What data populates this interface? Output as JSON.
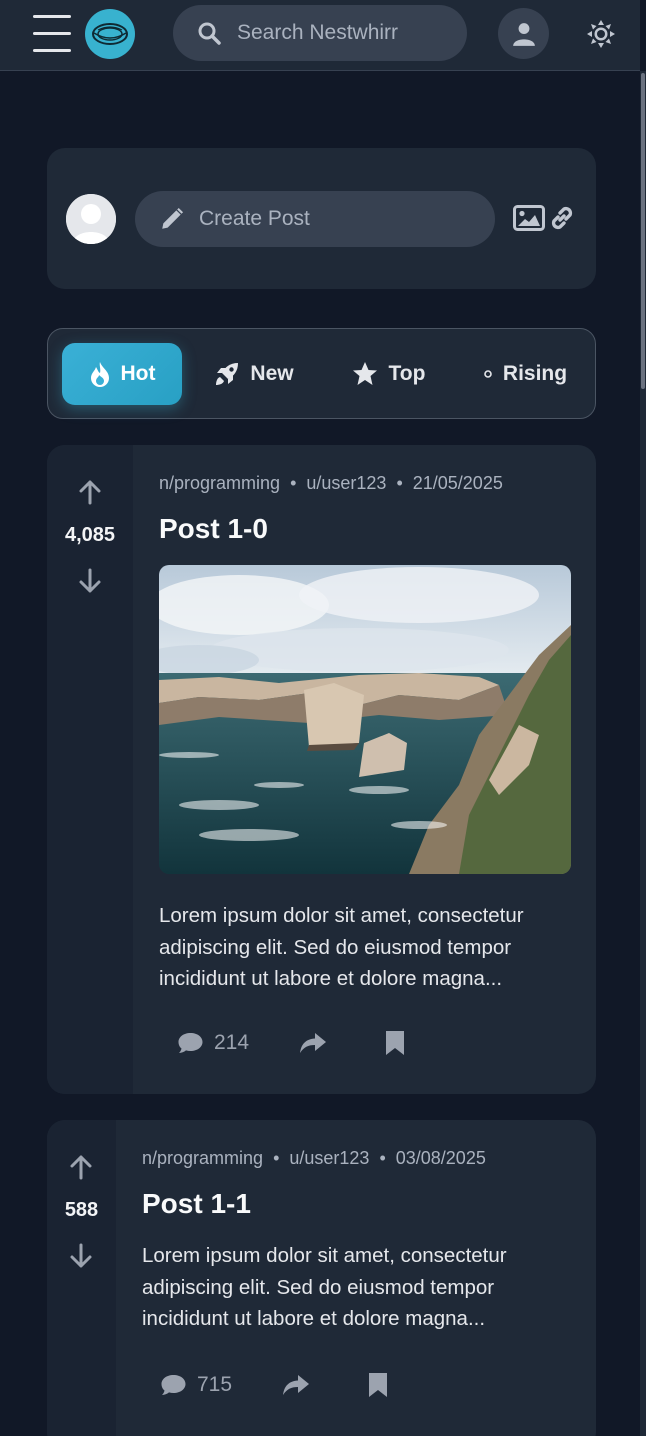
{
  "header": {
    "search_placeholder": "Search Nestwhirr"
  },
  "create_post": {
    "placeholder": "Create Post"
  },
  "tabs": [
    {
      "label": "Hot",
      "active": true
    },
    {
      "label": "New",
      "active": false
    },
    {
      "label": "Top",
      "active": false
    },
    {
      "label": "Rising",
      "active": false
    }
  ],
  "posts": [
    {
      "community": "n/programming",
      "author": "u/user123",
      "date": "21/05/2025",
      "title": "Post 1-0",
      "score": "4,085",
      "body": "Lorem ipsum dolor sit amet, consectetur adipiscing elit. Sed do eiusmod tempor incididunt ut labore et dolore magna...",
      "comments": "214",
      "has_image": true
    },
    {
      "community": "n/programming",
      "author": "u/user123",
      "date": "03/08/2025",
      "title": "Post 1-1",
      "score": "588",
      "body": "Lorem ipsum dolor sit amet, consectetur adipiscing elit. Sed do eiusmod tempor incididunt ut labore et dolore magna...",
      "comments": "715",
      "has_image": false
    }
  ],
  "colors": {
    "accent": "#38b2cf",
    "background": "#111827",
    "card": "#1f2937"
  }
}
